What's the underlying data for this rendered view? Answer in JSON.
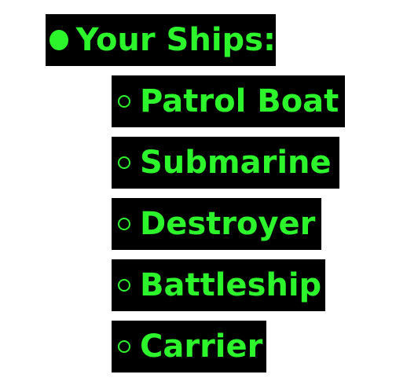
{
  "colors": {
    "text": "#2cf52c",
    "label_background": "#000000",
    "page_background": "#ffffff"
  },
  "header": {
    "bullet_icon": "filled-circle-icon",
    "title": "Your Ships:"
  },
  "ships": [
    {
      "bullet_icon": "hollow-circle-icon",
      "name": "Patrol Boat"
    },
    {
      "bullet_icon": "hollow-circle-icon",
      "name": "Submarine"
    },
    {
      "bullet_icon": "hollow-circle-icon",
      "name": "Destroyer"
    },
    {
      "bullet_icon": "hollow-circle-icon",
      "name": "Battleship"
    },
    {
      "bullet_icon": "hollow-circle-icon",
      "name": "Carrier"
    }
  ]
}
